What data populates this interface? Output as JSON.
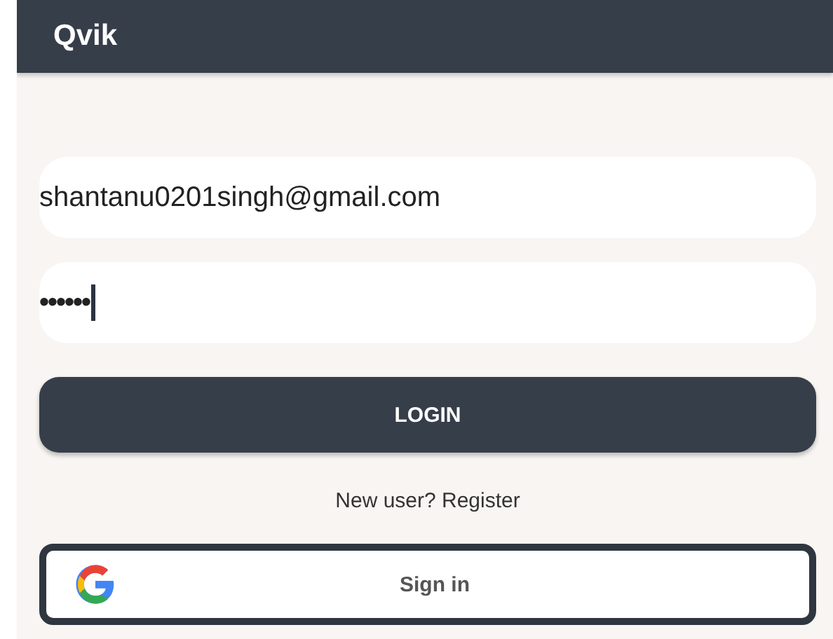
{
  "app_bar": {
    "title": "Qvik"
  },
  "email_field": {
    "value": "shantanu0201singh@gmail.com"
  },
  "password_field": {
    "value": "••••••",
    "focused": true
  },
  "login_button": {
    "label": "LOGIN"
  },
  "register_link": {
    "label": "New user? Register"
  },
  "google_button": {
    "label": "Sign in"
  }
}
